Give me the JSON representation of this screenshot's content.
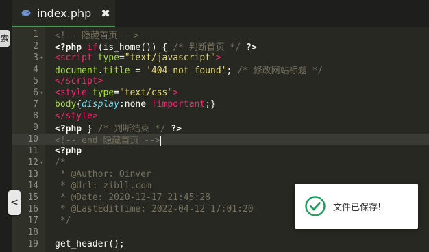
{
  "tab": {
    "title": "index.php",
    "close_label": "✖",
    "icon": "php-elephant-icon"
  },
  "left_stub": {
    "label": "索"
  },
  "collapse_button": {
    "label": "<",
    "icon": "chevron-left-icon"
  },
  "toast": {
    "message": "文件已保存!",
    "icon": "check-circle-icon",
    "accent": "#1f9e5e"
  },
  "editor": {
    "active_line": 10,
    "lines": [
      {
        "n": "1",
        "fold": "",
        "tokens": [
          [
            "t-com",
            "<!-- 隐藏首页 -->"
          ]
        ]
      },
      {
        "n": "2",
        "fold": "",
        "tokens": [
          [
            "t-php",
            "<?php "
          ],
          [
            "t-kw",
            "if"
          ],
          [
            "t-pl",
            "("
          ],
          [
            "t-pl",
            "is_home"
          ],
          [
            "t-pl",
            "()) { "
          ],
          [
            "t-com",
            "/* 判断首页 */"
          ],
          [
            "t-pl",
            " "
          ],
          [
            "t-php",
            "?>"
          ]
        ]
      },
      {
        "n": "3",
        "fold": "▾",
        "tokens": [
          [
            "t-tag",
            "<script "
          ],
          [
            "t-attr",
            "type"
          ],
          [
            "t-pl",
            "="
          ],
          [
            "t-str",
            "\"text/javascript\""
          ],
          [
            "t-tag",
            ">"
          ]
        ]
      },
      {
        "n": "4",
        "fold": "",
        "tokens": [
          [
            "t-attr",
            "document"
          ],
          [
            "t-pl",
            "."
          ],
          [
            "t-attr",
            "title"
          ],
          [
            "t-pl",
            " = "
          ],
          [
            "t-str",
            "'404 not found'"
          ],
          [
            "t-pl",
            "; "
          ],
          [
            "t-com",
            "/* 修改网站标题 */"
          ]
        ]
      },
      {
        "n": "5",
        "fold": "",
        "tokens": [
          [
            "t-tag",
            "</script"
          ],
          [
            "t-tag",
            ">"
          ]
        ]
      },
      {
        "n": "6",
        "fold": "▾",
        "tokens": [
          [
            "t-tag",
            "<style "
          ],
          [
            "t-attr",
            "type"
          ],
          [
            "t-pl",
            "="
          ],
          [
            "t-str",
            "\"text/css\""
          ],
          [
            "t-tag",
            ">"
          ]
        ]
      },
      {
        "n": "7",
        "fold": "",
        "tokens": [
          [
            "t-attr",
            "body"
          ],
          [
            "t-pl",
            "{"
          ],
          [
            "t-it",
            "display"
          ],
          [
            "t-pl",
            ":"
          ],
          [
            "t-pl",
            "none "
          ],
          [
            "t-op",
            "!important"
          ],
          [
            "t-pl",
            ";}"
          ]
        ]
      },
      {
        "n": "8",
        "fold": "",
        "tokens": [
          [
            "t-tag",
            "</style"
          ],
          [
            "t-tag",
            ">"
          ]
        ]
      },
      {
        "n": "9",
        "fold": "",
        "tokens": [
          [
            "t-php",
            "<?php "
          ],
          [
            "t-pl",
            "} "
          ],
          [
            "t-com",
            "/* 判断结束 */"
          ],
          [
            "t-pl",
            " "
          ],
          [
            "t-php",
            "?>"
          ]
        ]
      },
      {
        "n": "10",
        "fold": "",
        "tokens": [
          [
            "t-com",
            "<!-- end 隐藏首页 -->"
          ]
        ]
      },
      {
        "n": "11",
        "fold": "",
        "tokens": [
          [
            "t-php",
            "<?php"
          ]
        ]
      },
      {
        "n": "12",
        "fold": "▾",
        "tokens": [
          [
            "t-com",
            "/*"
          ]
        ]
      },
      {
        "n": "13",
        "fold": "",
        "tokens": [
          [
            "t-com",
            " * @Author: Qinver"
          ]
        ]
      },
      {
        "n": "14",
        "fold": "",
        "tokens": [
          [
            "t-com",
            " * @Url: zibll.com"
          ]
        ]
      },
      {
        "n": "15",
        "fold": "",
        "tokens": [
          [
            "t-com",
            " * @Date: 2020-12-17 21:45:28"
          ]
        ]
      },
      {
        "n": "16",
        "fold": "",
        "tokens": [
          [
            "t-com",
            " * @LastEditTime: 2022-04-12 17:01:20"
          ]
        ]
      },
      {
        "n": "17",
        "fold": "",
        "tokens": [
          [
            "t-com",
            " */"
          ]
        ]
      },
      {
        "n": "18",
        "fold": "",
        "tokens": []
      },
      {
        "n": "19",
        "fold": "",
        "tokens": [
          [
            "t-pl",
            "get_header();"
          ]
        ]
      }
    ]
  },
  "colors": {
    "background": "#272822",
    "tab_underline": "#3fa14a",
    "comment": "#75715e",
    "keyword": "#f92672",
    "string": "#e6db74",
    "attribute": "#a6e22e"
  }
}
